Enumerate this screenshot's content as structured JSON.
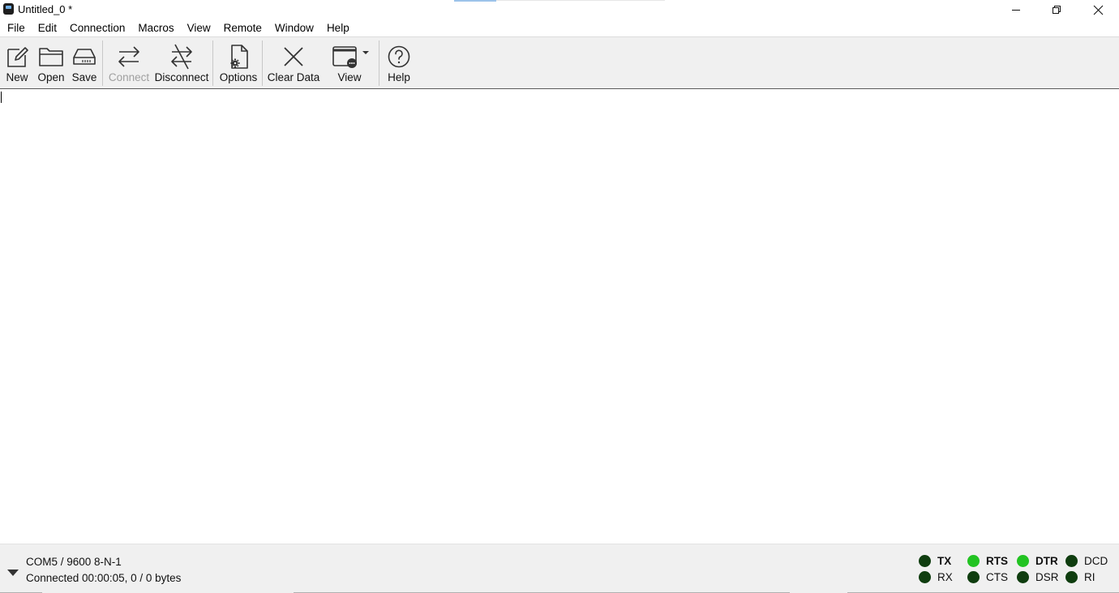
{
  "window": {
    "title": "Untitled_0 *"
  },
  "menu": [
    "File",
    "Edit",
    "Connection",
    "Macros",
    "View",
    "Remote",
    "Window",
    "Help"
  ],
  "toolbar": {
    "new_label": "New",
    "open_label": "Open",
    "save_label": "Save",
    "connect_label": "Connect",
    "disconnect_label": "Disconnect",
    "options_label": "Options",
    "clear_label": "Clear Data",
    "view_label": "View",
    "help_label": "Help"
  },
  "status": {
    "port": "COM5 / 9600 8-N-1",
    "connection": "Connected 00:00:05, 0 / 0 bytes"
  },
  "signals": {
    "tx": "TX",
    "rx": "RX",
    "rts": "RTS",
    "cts": "CTS",
    "dtr": "DTR",
    "dsr": "DSR",
    "dcd": "DCD",
    "ri": "RI"
  },
  "colors": {
    "led_on": "#22c322",
    "led_off": "#0f3d0f",
    "disabled_text": "#a0a0a0"
  }
}
